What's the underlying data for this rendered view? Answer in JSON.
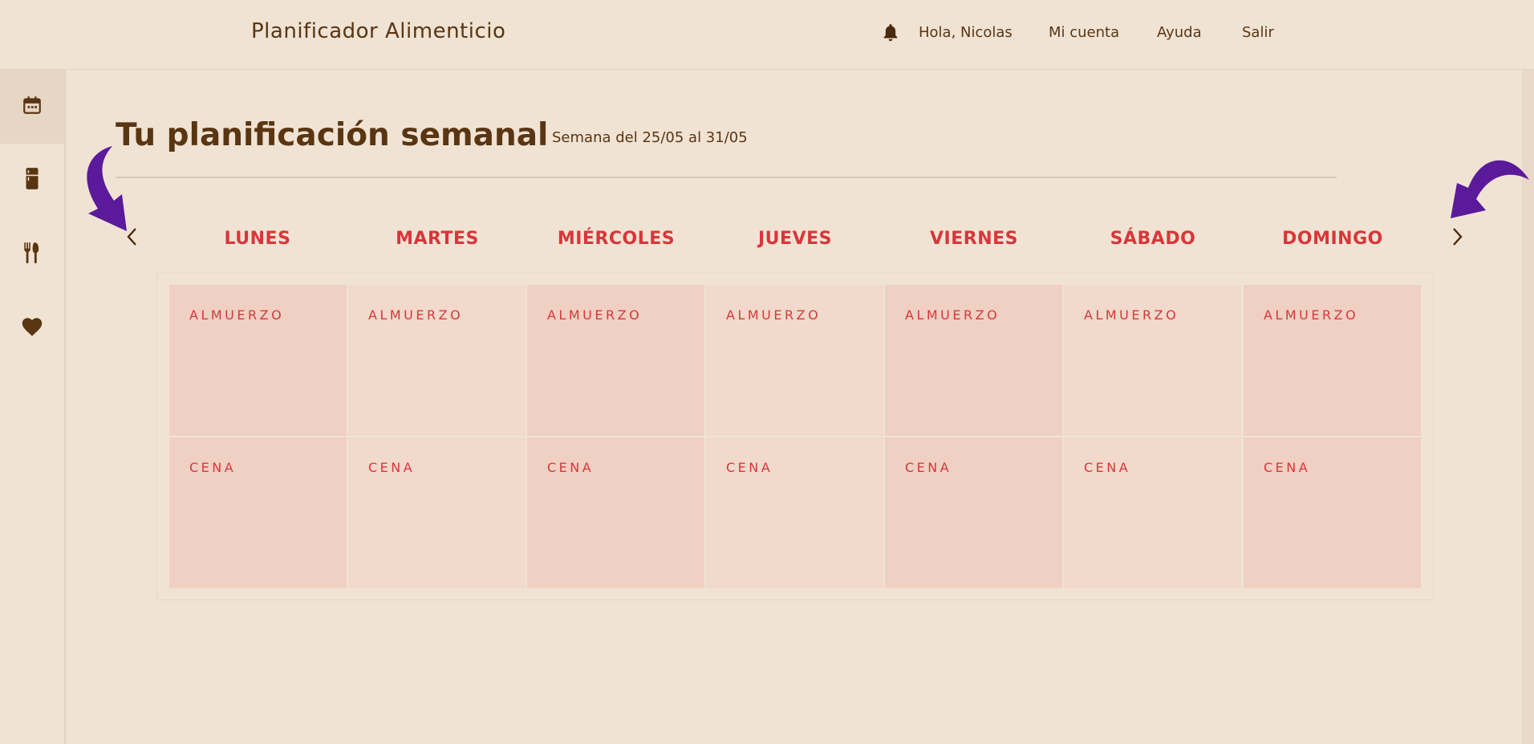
{
  "header": {
    "app_title": "Planificador Alimenticio",
    "greeting": "Hola, Nicolas",
    "nav": {
      "account": "Mi cuenta",
      "help": "Ayuda",
      "exit": "Salir"
    }
  },
  "sidebar": {
    "items": [
      {
        "name": "calendar",
        "icon": "calendar-icon",
        "active": true
      },
      {
        "name": "fridge",
        "icon": "fridge-icon",
        "active": false
      },
      {
        "name": "recipes",
        "icon": "cutlery-icon",
        "active": false
      },
      {
        "name": "favorites",
        "icon": "heart-icon",
        "active": false
      }
    ]
  },
  "main": {
    "title": "Tu planificación semanal",
    "week_range": "Semana del 25/05 al 31/05",
    "days": [
      "LUNES",
      "MARTES",
      "MIÉRCOLES",
      "JUEVES",
      "VIERNES",
      "SÁBADO",
      "DOMINGO"
    ],
    "meals": [
      "ALMUERZO",
      "CENA"
    ]
  },
  "colors": {
    "background": "#f0e3d4",
    "brown": "#5a3512",
    "accent_red": "#d8363a",
    "cell_dark": "#f0d0c3",
    "cell_light": "#f1d9cb",
    "annotation_purple": "#5a1a9a"
  }
}
